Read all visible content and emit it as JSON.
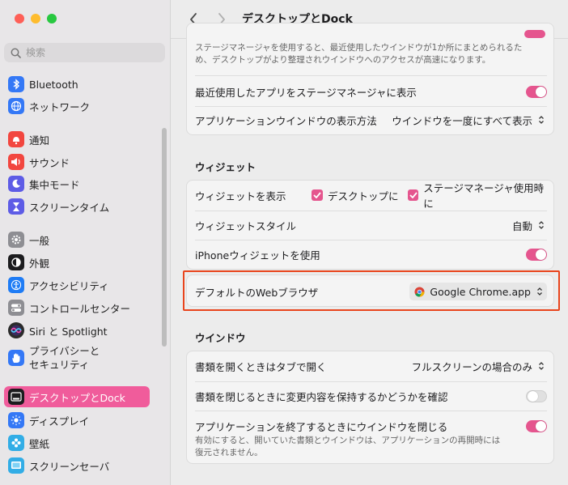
{
  "window": {
    "title": "デスクトップとDock"
  },
  "sidebar": {
    "search_placeholder": "検索",
    "items": [
      {
        "label": "Bluetooth",
        "icon": "bluetooth-icon",
        "color": "#3478f6"
      },
      {
        "label": "ネットワーク",
        "icon": "globe-icon",
        "color": "#3478f6"
      },
      {
        "label": "通知",
        "icon": "bell-icon",
        "color": "#f2463f"
      },
      {
        "label": "サウンド",
        "icon": "speaker-icon",
        "color": "#f2463f"
      },
      {
        "label": "集中モード",
        "icon": "moon-icon",
        "color": "#5e5ce6"
      },
      {
        "label": "スクリーンタイム",
        "icon": "hourglass-icon",
        "color": "#5e5ce6"
      },
      {
        "label": "一般",
        "icon": "gear-icon",
        "color": "#8e8e93"
      },
      {
        "label": "外観",
        "icon": "appearance-icon",
        "color": "#1c1c1e"
      },
      {
        "label": "アクセシビリティ",
        "icon": "accessibility-icon",
        "color": "#1f7cf5"
      },
      {
        "label": "コントロールセンター",
        "icon": "toggles-icon",
        "color": "#8e8e93"
      },
      {
        "label": "Siri と Spotlight",
        "icon": "siri-icon",
        "color": "#2b2b2b"
      },
      {
        "label": "プライバシーと\nセキュリティ",
        "icon": "hand-icon",
        "color": "#3478f6"
      },
      {
        "label": "デスクトップとDock",
        "icon": "dock-icon",
        "color": "#1c1c1e",
        "active": true
      },
      {
        "label": "ディスプレイ",
        "icon": "sun-icon",
        "color": "#3478f6"
      },
      {
        "label": "壁紙",
        "icon": "flower-icon",
        "color": "#32ade6"
      },
      {
        "label": "スクリーンセーバ",
        "icon": "screensaver-icon",
        "color": "#32ade6"
      }
    ]
  },
  "main": {
    "stage_manager_desc": "ステージマネージャを使用すると、最近使用したウインドウが1か所にまとめられるため、デスクトップがより整理されウインドウへのアクセスが高速になります。",
    "recent_apps_label": "最近使用したアプリをステージマネージャに表示",
    "app_windows_label": "アプリケーションウインドウの表示方法",
    "app_windows_value": "ウインドウを一度にすべて表示",
    "widgets_section": "ウィジェット",
    "show_widgets_label": "ウィジェットを表示",
    "show_widgets_desktop": "デスクトップに",
    "show_widgets_stage": "ステージマネージャ使用時に",
    "widget_style_label": "ウィジェットスタイル",
    "widget_style_value": "自動",
    "iphone_widgets_label": "iPhoneウィジェットを使用",
    "default_browser_label": "デフォルトのWebブラウザ",
    "default_browser_value": "Google Chrome.app",
    "windows_section": "ウインドウ",
    "prefer_tabs_label": "書類を開くときはタブで開く",
    "prefer_tabs_value": "フルスクリーンの場合のみ",
    "ask_keep_changes_label": "書類を閉じるときに変更内容を保持するかどうかを確認",
    "close_windows_label": "アプリケーションを終了するときにウインドウを閉じる",
    "close_windows_desc": "有効にすると、開いていた書類とウインドウは、アプリケーションの再開時には復元されません。"
  },
  "colors": {
    "accent": "#e5558e",
    "sidebar_active": "#f05c9b",
    "highlight_border": "#e9441c"
  }
}
